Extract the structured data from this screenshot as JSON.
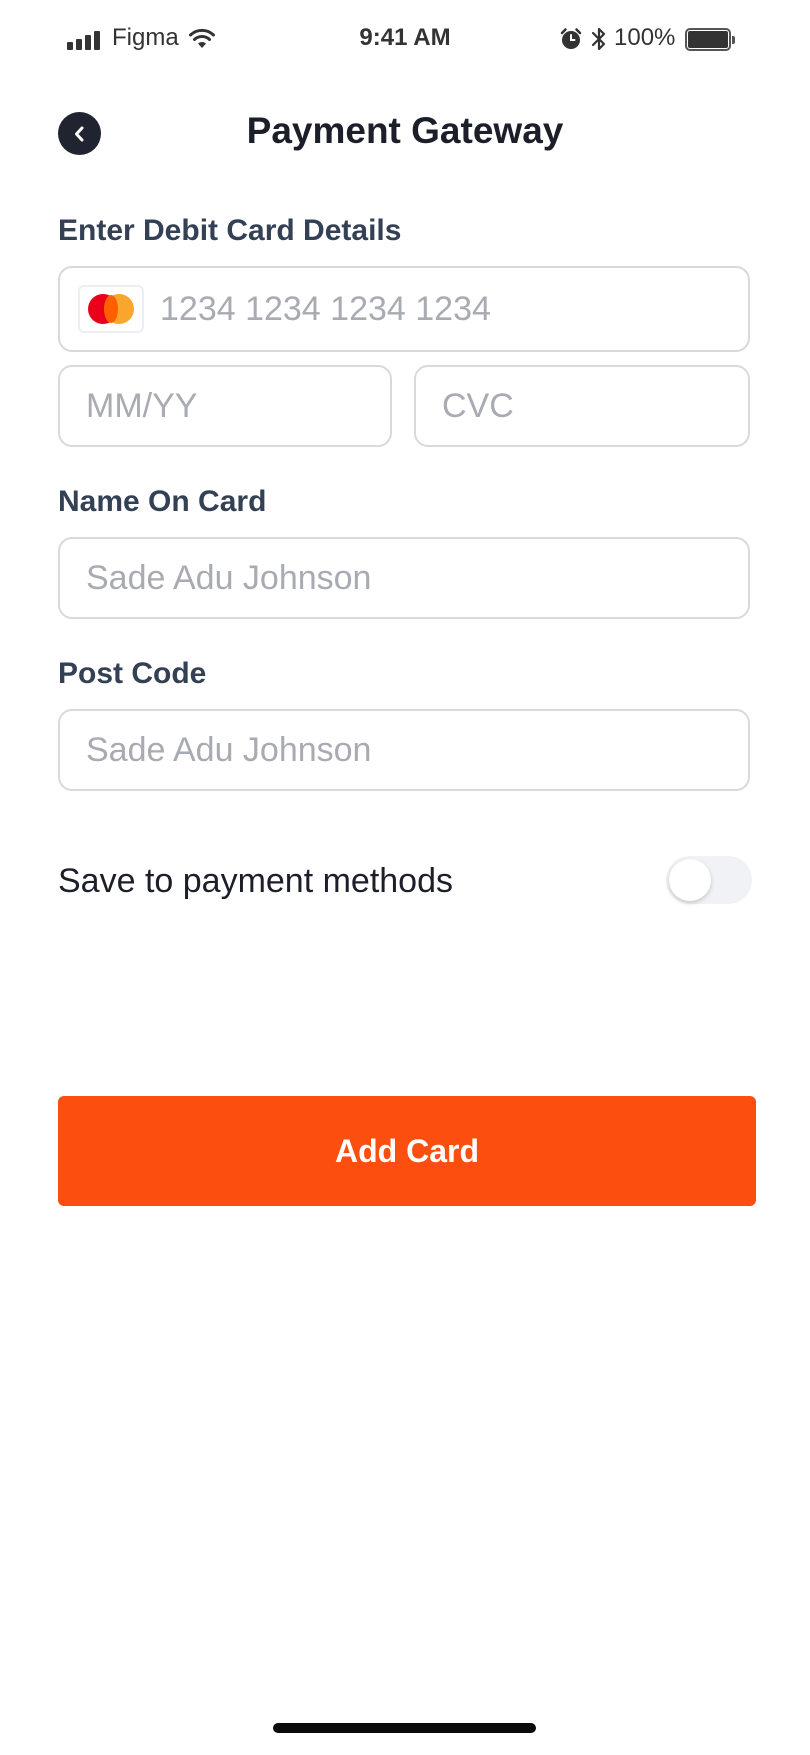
{
  "status_bar": {
    "carrier": "Figma",
    "time": "9:41 AM",
    "battery": "100%",
    "icons": [
      "signal-icon",
      "wifi-icon",
      "alarm-icon",
      "bluetooth-icon",
      "battery-icon"
    ]
  },
  "header": {
    "title": "Payment Gateway",
    "back_icon": "chevron-left-icon"
  },
  "card_details": {
    "label": "Enter Debit Card Details",
    "card_brand_icon": "mastercard-icon",
    "card_number_placeholder": "1234 1234 1234 1234",
    "expiry_placeholder": "MM/YY",
    "cvc_placeholder": "CVC"
  },
  "name_on_card": {
    "label": "Name On Card",
    "placeholder": "Sade Adu Johnson"
  },
  "post_code": {
    "label": "Post Code",
    "placeholder": "Sade Adu Johnson"
  },
  "save_option": {
    "label": "Save to payment methods",
    "enabled": false
  },
  "actions": {
    "add_card_label": "Add Card"
  },
  "colors": {
    "accent": "#fc4f0f",
    "label": "#344054",
    "border": "#d7d9e0",
    "back_button": "#1f2430"
  }
}
